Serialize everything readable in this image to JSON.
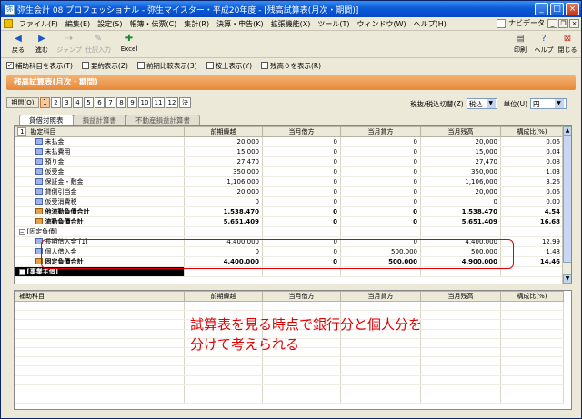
{
  "window": {
    "title": "弥生会計 08 プロフェッショナル - 弥生マイスター・平成20年度 - [残高試算表(月次・期間)]",
    "buttons": [
      "_",
      "□",
      "×"
    ]
  },
  "menu": {
    "items": [
      "ファイル(F)",
      "編集(E)",
      "設定(S)",
      "帳簿・伝票(C)",
      "集計(R)",
      "決算・申告(K)",
      "拡張機能(X)",
      "ツール(T)",
      "ウィンドウ(W)",
      "ヘルプ(H)"
    ],
    "navi_label": "ナビデータ"
  },
  "toolbar": {
    "back": "戻る",
    "forward": "進む",
    "jump": "ジャンプ",
    "open_journal": "仕訳入力",
    "excel": "Excel",
    "print": "印刷",
    "help": "ヘルプ",
    "close": "閉じる"
  },
  "options": [
    {
      "label": "補助科目を表示(T)",
      "checked": true,
      "enabled": true
    },
    {
      "label": "要約表示(Z)",
      "checked": false,
      "enabled": true
    },
    {
      "label": "前期比較表示(3)",
      "checked": false,
      "enabled": true
    },
    {
      "label": "按上表示(Y)",
      "checked": false,
      "enabled": true
    },
    {
      "label": "残高０を表示(R)",
      "checked": false,
      "enabled": true
    }
  ],
  "report": {
    "title": "残高試算表(月次・期間)",
    "period_label": "期間(Q)",
    "months": [
      "1",
      "2",
      "3",
      "4",
      "5",
      "6",
      "7",
      "8",
      "9",
      "10",
      "11",
      "12",
      "決"
    ],
    "selected_month": "1",
    "tax_label": "税抜/税込切替(Z)",
    "tax_value": "税込",
    "unit_label": "単位(U)",
    "unit_value": "円",
    "tabs": [
      "貸借対照表",
      "損益計算書",
      "不動産損益計算書"
    ],
    "active_tab": "貸借対照表"
  },
  "grid_main": {
    "corner": "1",
    "columns": [
      "勘定科目",
      "前期繰越",
      "当月借方",
      "当月貸方",
      "当月残高",
      "構成比(%)"
    ],
    "rows": [
      {
        "name": "未払金",
        "icon": "account",
        "prev": "20,000",
        "debit": "0",
        "credit": "0",
        "balance": "20,000",
        "ratio": "0.06"
      },
      {
        "name": "未払費用",
        "icon": "account",
        "prev": "15,000",
        "debit": "0",
        "credit": "0",
        "balance": "15,000",
        "ratio": "0.04"
      },
      {
        "name": "預り金",
        "icon": "account",
        "prev": "27,470",
        "debit": "0",
        "credit": "0",
        "balance": "27,470",
        "ratio": "0.08"
      },
      {
        "name": "仮受金",
        "icon": "account",
        "prev": "350,000",
        "debit": "0",
        "credit": "0",
        "balance": "350,000",
        "ratio": "1.03"
      },
      {
        "name": "保証金・敷金",
        "icon": "account",
        "prev": "1,106,000",
        "debit": "0",
        "credit": "0",
        "balance": "1,106,000",
        "ratio": "3.26"
      },
      {
        "name": "貸倒引当金",
        "icon": "account",
        "prev": "20,000",
        "debit": "0",
        "credit": "0",
        "balance": "20,000",
        "ratio": "0.06"
      },
      {
        "name": "仮受消費税",
        "icon": "account",
        "prev": "0",
        "debit": "0",
        "credit": "0",
        "balance": "0",
        "ratio": "0.00"
      },
      {
        "name": "他流動負債合計",
        "icon": "sum",
        "bold": true,
        "prev": "1,538,470",
        "debit": "0",
        "credit": "0",
        "balance": "1,538,470",
        "ratio": "4.54"
      },
      {
        "name": "流動負債合計",
        "icon": "sum",
        "bold": true,
        "prev": "5,651,409",
        "debit": "0",
        "credit": "0",
        "balance": "5,651,409",
        "ratio": "16.68"
      },
      {
        "name": "[固定負債]",
        "icon": "folder",
        "prev": "",
        "debit": "",
        "credit": "",
        "balance": "",
        "ratio": ""
      },
      {
        "name": "長期借入金 [1]",
        "icon": "account",
        "prev": "4,400,000",
        "debit": "0",
        "credit": "0",
        "balance": "4,400,000",
        "ratio": "12.99"
      },
      {
        "name": "個人借入金",
        "icon": "account",
        "prev": "0",
        "debit": "0",
        "credit": "500,000",
        "balance": "500,000",
        "ratio": "1.48"
      },
      {
        "name": "固定負債合計",
        "icon": "sum",
        "bold": true,
        "prev": "4,400,000",
        "debit": "0",
        "credit": "500,000",
        "balance": "4,900,000",
        "ratio": "14.46"
      },
      {
        "name": "[事業主借]",
        "icon": "folder",
        "selected": true,
        "prev": "",
        "debit": "",
        "credit": "",
        "balance": "",
        "ratio": ""
      }
    ]
  },
  "grid_sub": {
    "columns": [
      "補助科目",
      "前期繰越",
      "当月借方",
      "当月貸方",
      "当月残高",
      "構成比(%)"
    ]
  },
  "annotation": {
    "line1": "試算表を見る時点で銀行分と個人分を",
    "line2": "分けて考えられる",
    "color": "#e00000"
  }
}
